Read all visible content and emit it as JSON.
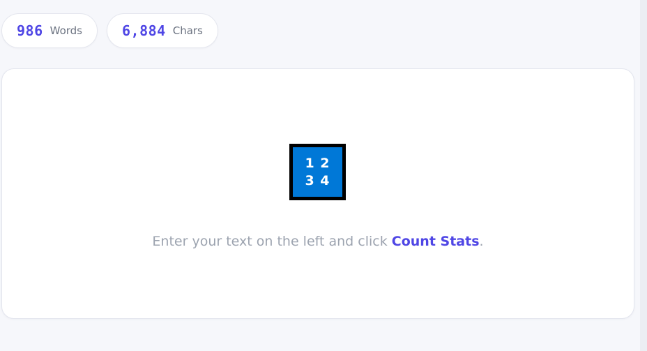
{
  "stats": {
    "words": {
      "value": "986",
      "label": "Words"
    },
    "chars": {
      "value": "6,884",
      "label": "Chars"
    }
  },
  "result_panel": {
    "icon": {
      "name": "number-grid-icon",
      "line1": "1 2",
      "line2": "3 4",
      "fill_color": "#0078d7",
      "border_color": "#000000"
    },
    "message_prefix": "Enter your text on the left and click ",
    "message_action": "Count Stats",
    "message_suffix": "."
  },
  "colors": {
    "accent": "#4f46e5",
    "muted_text": "#9ca3af",
    "label_text": "#6b7280",
    "background": "#f6f7fb"
  }
}
